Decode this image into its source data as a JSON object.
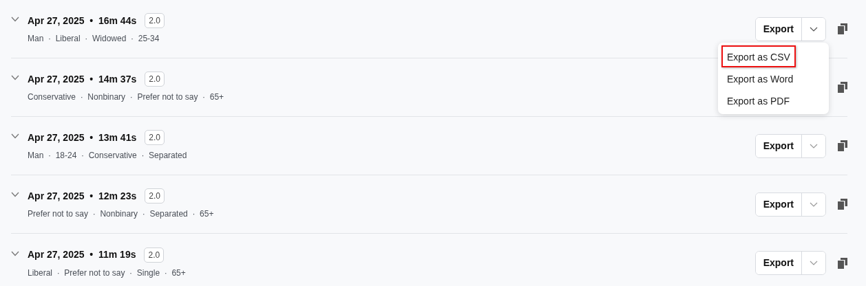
{
  "sessions": [
    {
      "title": "Apr 27, 2025  •  16m 44s",
      "version": "2.0",
      "tags": "Man  ·  Liberal  ·  Widowed  ·  25-34",
      "expanded": false,
      "menu_open": true,
      "export_label": "Export"
    },
    {
      "title": "Apr 27, 2025  •  14m 37s",
      "version": "2.0",
      "tags": "Conservative  ·  Nonbinary  ·  Prefer not to say  ·  65+",
      "expanded": false
    },
    {
      "title": "Apr 27, 2025  •  13m 41s",
      "version": "2.0",
      "tags": "Man  ·  18-24  ·  Conservative  ·  Separated",
      "expanded": false,
      "menu_open": false,
      "export_label": "Export"
    },
    {
      "title": "Apr 27, 2025  •  12m 23s",
      "version": "2.0",
      "tags": "Prefer not to say  ·  Nonbinary  ·  Separated  ·  65+",
      "expanded": false,
      "menu_open": false,
      "export_label": "Export"
    },
    {
      "title": "Apr 27, 2025  •  11m 19s",
      "version": "2.0",
      "tags": "Liberal  ·  Prefer not to say  ·  Single  ·  65+",
      "expanded": false,
      "menu_open": false,
      "export_label": "Export"
    }
  ],
  "export_menu": [
    {
      "label": "Export as CSV",
      "selected": true
    },
    {
      "label": "Export as Word",
      "selected": false
    },
    {
      "label": "Export as PDF",
      "selected": false
    }
  ]
}
